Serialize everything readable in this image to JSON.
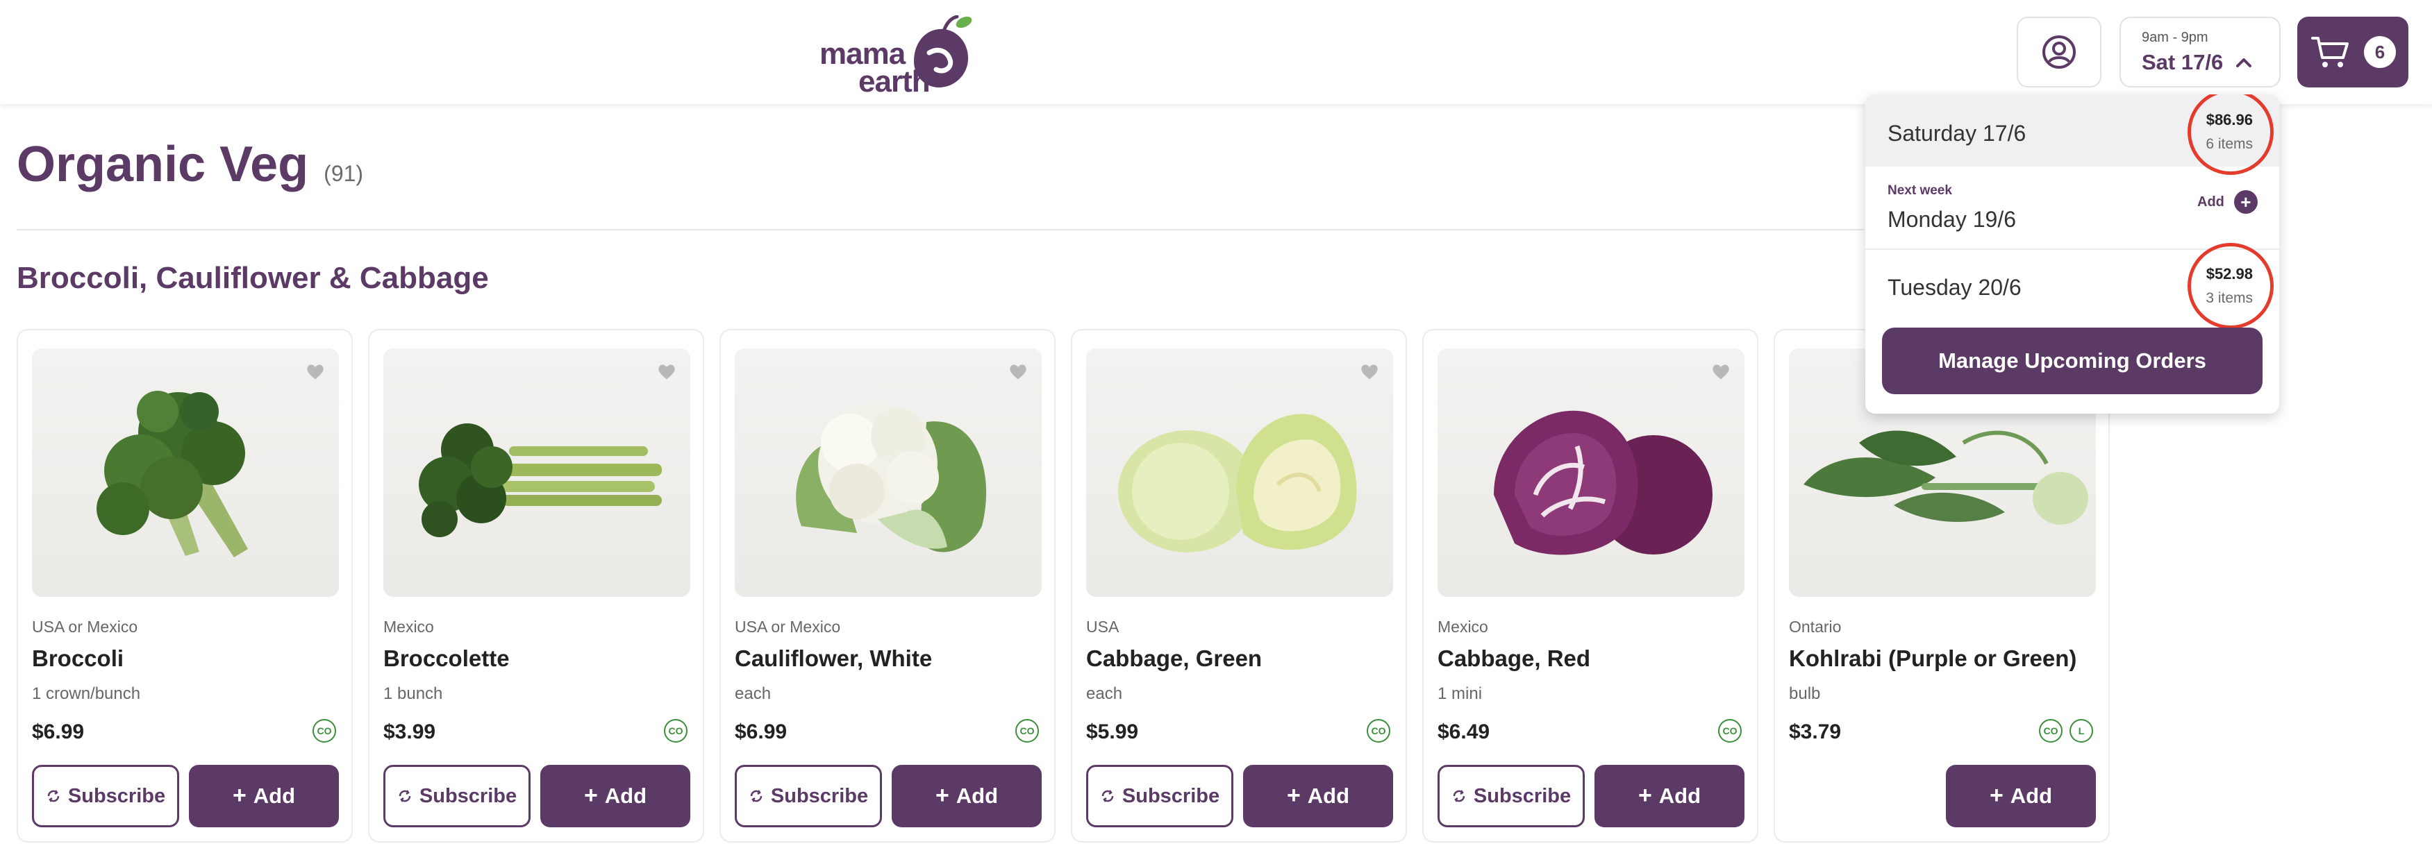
{
  "header": {
    "logo_line1": "mama",
    "logo_line2": "earth",
    "delivery_hours": "9am - 9pm",
    "delivery_date": "Sat 17/6",
    "cart_count": "6"
  },
  "page": {
    "title": "Organic Veg",
    "count": "(91)",
    "section_title": "Broccoli, Cauliflower & Cabbage"
  },
  "products": [
    {
      "origin": "USA or Mexico",
      "name": "Broccoli",
      "unit": "1 crown/bunch",
      "price": "$6.99",
      "badges": [
        "CO"
      ],
      "subscribe": "Subscribe",
      "add": "Add"
    },
    {
      "origin": "Mexico",
      "name": "Broccolette",
      "unit": "1 bunch",
      "price": "$3.99",
      "badges": [
        "CO"
      ],
      "subscribe": "Subscribe",
      "add": "Add"
    },
    {
      "origin": "USA or Mexico",
      "name": "Cauliflower, White",
      "unit": "each",
      "price": "$6.99",
      "badges": [
        "CO"
      ],
      "subscribe": "Subscribe",
      "add": "Add"
    },
    {
      "origin": "USA",
      "name": "Cabbage, Green",
      "unit": "each",
      "price": "$5.99",
      "badges": [
        "CO"
      ],
      "subscribe": "Subscribe",
      "add": "Add"
    },
    {
      "origin": "Mexico",
      "name": "Cabbage, Red",
      "unit": "1 mini",
      "price": "$6.49",
      "badges": [
        "CO"
      ],
      "subscribe": "Subscribe",
      "add": "Add"
    },
    {
      "origin": "Ontario",
      "name": "Kohlrabi (Purple or Green)",
      "unit": "bulb",
      "price": "$3.79",
      "badges": [
        "CO",
        "L"
      ],
      "add": "Add"
    }
  ],
  "dropdown": {
    "selected_label": "Saturday 17/6",
    "selected_total": "$86.96",
    "selected_items": "6 items",
    "next_week_label": "Next week",
    "monday_label": "Monday 19/6",
    "monday_add": "Add",
    "tuesday_label": "Tuesday 20/6",
    "tuesday_total": "$52.98",
    "tuesday_items": "3 items",
    "manage_label": "Manage Upcoming Orders"
  },
  "colors": {
    "brand_purple": "#5b3a66",
    "highlight_red": "#e53b2c",
    "badge_green": "#3b8f3b"
  }
}
